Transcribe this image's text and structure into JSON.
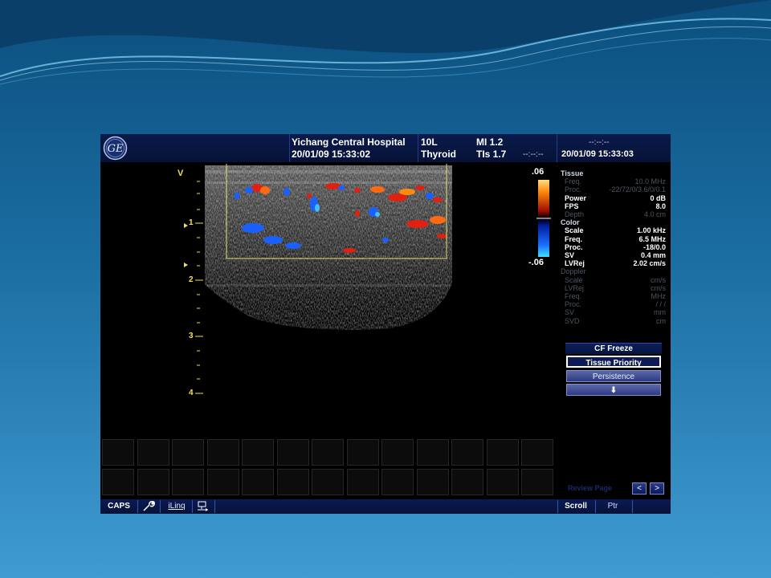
{
  "header": {
    "hospital": "Yichang Central Hospital",
    "datetime": "20/01/09 15:33:02",
    "probe": "10L",
    "preset": "Thyroid",
    "mi": "MI 1.2",
    "tis": "TIs 1.7",
    "timer": "--:--:--",
    "right_timer": "--:--:--",
    "right_datetime": "20/01/09 15:33:03"
  },
  "image": {
    "orientation_marker": "V",
    "depth_ticks": [
      "1",
      "2",
      "3",
      "4"
    ],
    "colorbar_top": ".06",
    "colorbar_bottom": "-.06"
  },
  "params": {
    "tissue": {
      "title": "Tissue",
      "rows": [
        {
          "label": "Freq.",
          "value": "10.0  MHz",
          "active": false
        },
        {
          "label": "Proc.",
          "value": "-22/72/0/3.6/0/0.1",
          "active": false
        },
        {
          "label": "Power",
          "value": "0  dB",
          "active": true
        },
        {
          "label": "FPS",
          "value": "8.0",
          "active": true
        },
        {
          "label": "Depth",
          "value": "4.0  cm",
          "active": false
        }
      ]
    },
    "color": {
      "title": "Color",
      "rows": [
        {
          "label": "Scale",
          "value": "1.00  kHz",
          "active": true
        },
        {
          "label": "Freq.",
          "value": "6.5  MHz",
          "active": true
        },
        {
          "label": "Proc.",
          "value": "-18/0.0",
          "active": true
        },
        {
          "label": "SV",
          "value": "0.4  mm",
          "active": true
        },
        {
          "label": "LVRej",
          "value": "2.02  cm/s",
          "active": true
        }
      ]
    },
    "doppler": {
      "title": "Doppler",
      "rows": [
        {
          "label": "Scale",
          "value": "cm/s",
          "active": false
        },
        {
          "label": "LVRej",
          "value": "cm/s",
          "active": false
        },
        {
          "label": "Freq.",
          "value": "MHz",
          "active": false
        },
        {
          "label": "Proc.",
          "value": "/ / /",
          "active": false
        },
        {
          "label": "SV",
          "value": "mm",
          "active": false
        },
        {
          "label": "SVD",
          "value": "cm",
          "active": false
        }
      ]
    }
  },
  "controls": {
    "cf_freeze": "CF Freeze",
    "tissue_priority": "Tissue Priority",
    "persistence": "Persistence",
    "down": "⬇",
    "review_page": "Review Page",
    "prev": "<",
    "next": ">"
  },
  "footer": {
    "caps": "CAPS",
    "iling": "iLinq",
    "scroll": "Scroll",
    "ptr": "Ptr"
  },
  "colors": {
    "header_bg": "#0a1a4a",
    "roi_box": "#e8e070",
    "flow_red": "#e02010",
    "flow_blue": "#1a60ff",
    "tick_yellow": "#f0e060"
  }
}
